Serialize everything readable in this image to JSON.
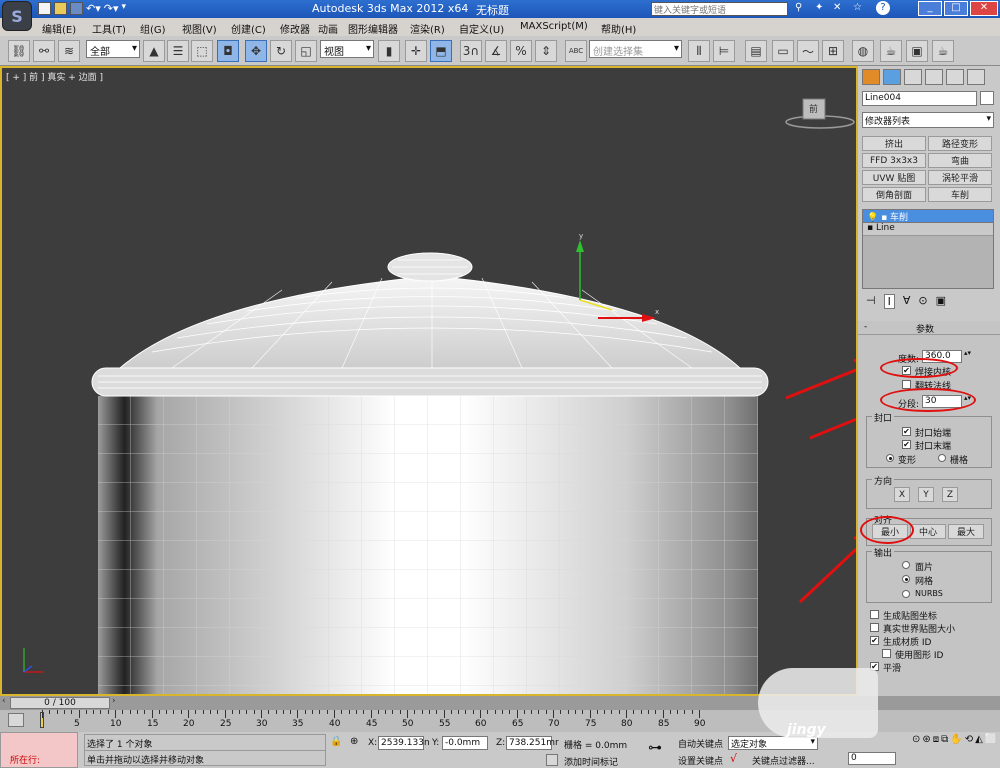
{
  "window": {
    "app_title": "Autodesk 3ds Max  2012 x64",
    "doc_title": "无标题",
    "search_placeholder": "键入关键字或短语"
  },
  "menu": [
    "编辑(E)",
    "工具(T)",
    "组(G)",
    "视图(V)",
    "创建(C)",
    "修改器",
    "动画",
    "图形编辑器",
    "渲染(R)",
    "自定义(U)",
    "MAXScript(M)",
    "帮助(H)"
  ],
  "toolbar": {
    "filter_select": "全部",
    "ref_coord": "视图",
    "named_sel": "创建选择集",
    "snap_3": "3",
    "pct": "%",
    "abc": "ABC"
  },
  "viewport": {
    "label": "[ + ] 前 ] 真实 + 边面 ]",
    "cube_label": "前",
    "gizmo_y": "y",
    "gizmo_x": "x"
  },
  "command_panel": {
    "object_name": "Line004",
    "modifier_list": "修改器列表",
    "quick_buttons": [
      "挤出",
      "路径变形",
      "FFD 3x3x3",
      "弯曲",
      "UVW 贴图",
      "涡轮平滑",
      "倒角剖面",
      "车削"
    ],
    "stack": [
      {
        "label": "车削",
        "selected": true
      },
      {
        "label": "Line",
        "selected": false
      }
    ],
    "rollout_title": "参数",
    "degrees_label": "度数:",
    "degrees_value": "360.0",
    "weld_core": "焊接内核",
    "flip_normals": "翻转法线",
    "segments_label": "分段:",
    "segments_value": "30",
    "cap_group": "封口",
    "cap_start": "封口始端",
    "cap_end": "封口末端",
    "morph": "变形",
    "grid": "栅格",
    "direction_group": "方向",
    "dir_x": "X",
    "dir_y": "Y",
    "dir_z": "Z",
    "align_group": "对齐",
    "align_min": "最小",
    "align_center": "中心",
    "align_max": "最大",
    "output_group": "输出",
    "out_patch": "面片",
    "out_mesh": "网格",
    "out_nurbs": "NURBS",
    "gen_map": "生成贴图坐标",
    "real_world": "真实世界贴图大小",
    "gen_mat": "生成材质 ID",
    "use_shape": "使用图形 ID",
    "smooth": "平滑"
  },
  "timeline": {
    "frame": "0 / 100",
    "ticks": [
      "5",
      "10",
      "15",
      "20",
      "25",
      "30",
      "35",
      "40",
      "45",
      "50",
      "55",
      "60",
      "65",
      "70",
      "75",
      "80",
      "85",
      "90"
    ]
  },
  "status": {
    "row_label": "所在行:",
    "selected": "选择了 1 个对象",
    "hint": "单击并拖动以选择并移动对象",
    "x_label": "X:",
    "x_val": "2539.133n",
    "y_label": "Y:",
    "y_val": "-0.0mm",
    "z_label": "Z:",
    "z_val": "738.251mr",
    "grid": "栅格 = 0.0mm",
    "auto_key": "自动关键点",
    "set_key": "设置关键点",
    "sel_obj": "选定对象",
    "key_filter": "关键点过滤器...",
    "add_tag": "添加时间标记",
    "frame_field": "0",
    "watermark": "jingy"
  },
  "colors": {
    "accent": "#d9b52d",
    "annotation": "#e01010",
    "titlebar": "#2d6fd0"
  }
}
